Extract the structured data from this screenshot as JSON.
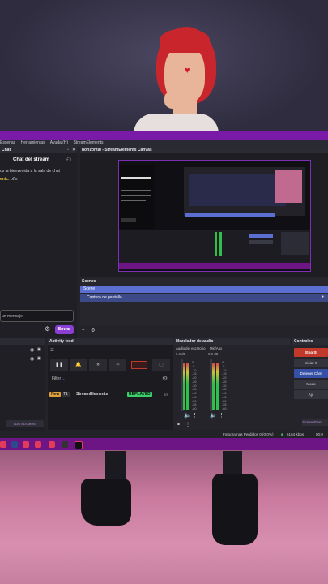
{
  "menubar": {
    "items": [
      "Escenas",
      "Herramientas",
      "Ayuda (H)",
      "StreamElements"
    ]
  },
  "chat": {
    "panel_title": "Chat",
    "header": "Chat del stream",
    "welcome": "os la bienvenida a la sala de chat",
    "user": "enic",
    "user_message": "oño",
    "input_placeholder": "un mensaje",
    "send_label": "Enviar"
  },
  "preview": {
    "title": "horizontal - StreamElements Canvas"
  },
  "scenes": {
    "header": "Scenes",
    "items": [
      "Scene",
      "Captura de pantalla"
    ]
  },
  "sources": {
    "add_label": "ADD ELEMENT"
  },
  "activity": {
    "title": "Activity feed",
    "filter_label": "Filter",
    "tag_new": "New",
    "tag_tier": "T1",
    "event_name": "StreamElements",
    "event_badge": "REPLAYED",
    "event_time": "5m"
  },
  "audio": {
    "title": "Mezclador de audio",
    "ch1_name": "Audio del escritorio",
    "ch1_db": "0.0 dB",
    "ch2_name": "Mic/Aux",
    "ch2_db": "0.0 dB",
    "scale": [
      "0",
      "-5",
      "-10",
      "-15",
      "-20",
      "-25",
      "-30",
      "-35",
      "-40",
      "-45",
      "-50",
      "-55",
      "-60"
    ]
  },
  "controls": {
    "title": "Controles",
    "buttons": [
      "Stop St",
      "Iniciar G",
      "Detener Cám",
      "Modo",
      "Aju"
    ],
    "se_label": "StreamElem"
  },
  "status": {
    "dropped": "Fotogramas Perdidos 0 (0.0%)",
    "kbps": "6164 kbps",
    "time": "00:0"
  },
  "colors": {
    "accent": "#7a1aa8",
    "button_purple": "#8b3fd4",
    "stop_red": "#c0392b",
    "scene_selected": "#5a6fd1"
  }
}
